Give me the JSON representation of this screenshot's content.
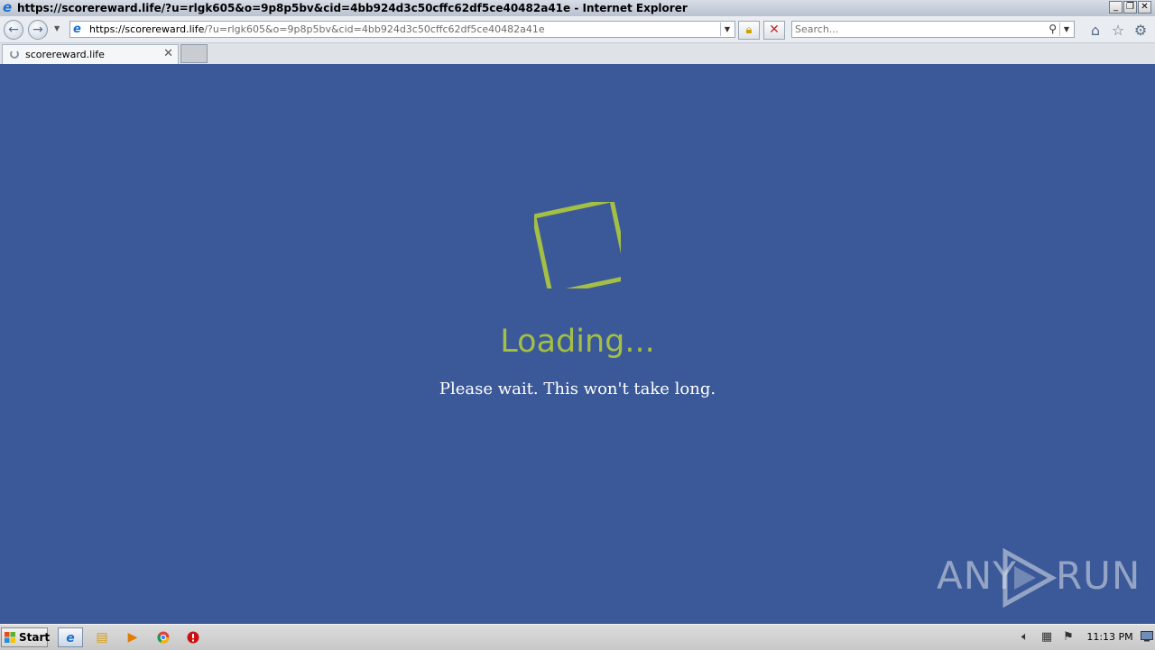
{
  "window": {
    "title": "https://scorereward.life/?u=rlgk605&o=9p8p5bv&cid=4bb924d3c50cffc62df5ce40482a41e - Internet Explorer",
    "minimize_icon": "minimize-icon",
    "restore_icon": "restore-icon",
    "close_icon": "close-icon"
  },
  "address_bar": {
    "url_host": "https://scorereward.life",
    "url_rest": "/?u=rlgk605&o=9p8p5bv&cid=4bb924d3c50cffc62df5ce40482a41e"
  },
  "search": {
    "placeholder": "Search..."
  },
  "tabs": [
    {
      "label": "scorereward.life",
      "loading": true
    }
  ],
  "page": {
    "heading": "Loading...",
    "message": "Please wait. This won't take long.",
    "accent_color": "#a4bf45",
    "background_color": "#3b5998"
  },
  "watermark": {
    "left": "ANY",
    "right": "RUN"
  },
  "taskbar": {
    "start_label": "Start",
    "clock": "11:13 PM",
    "pinned": [
      "internet-explorer-icon",
      "file-explorer-icon",
      "media-player-icon",
      "chrome-icon",
      "stop-sign-icon"
    ],
    "tray": [
      "volume-icon",
      "network-icon",
      "action-center-flag-icon"
    ]
  }
}
